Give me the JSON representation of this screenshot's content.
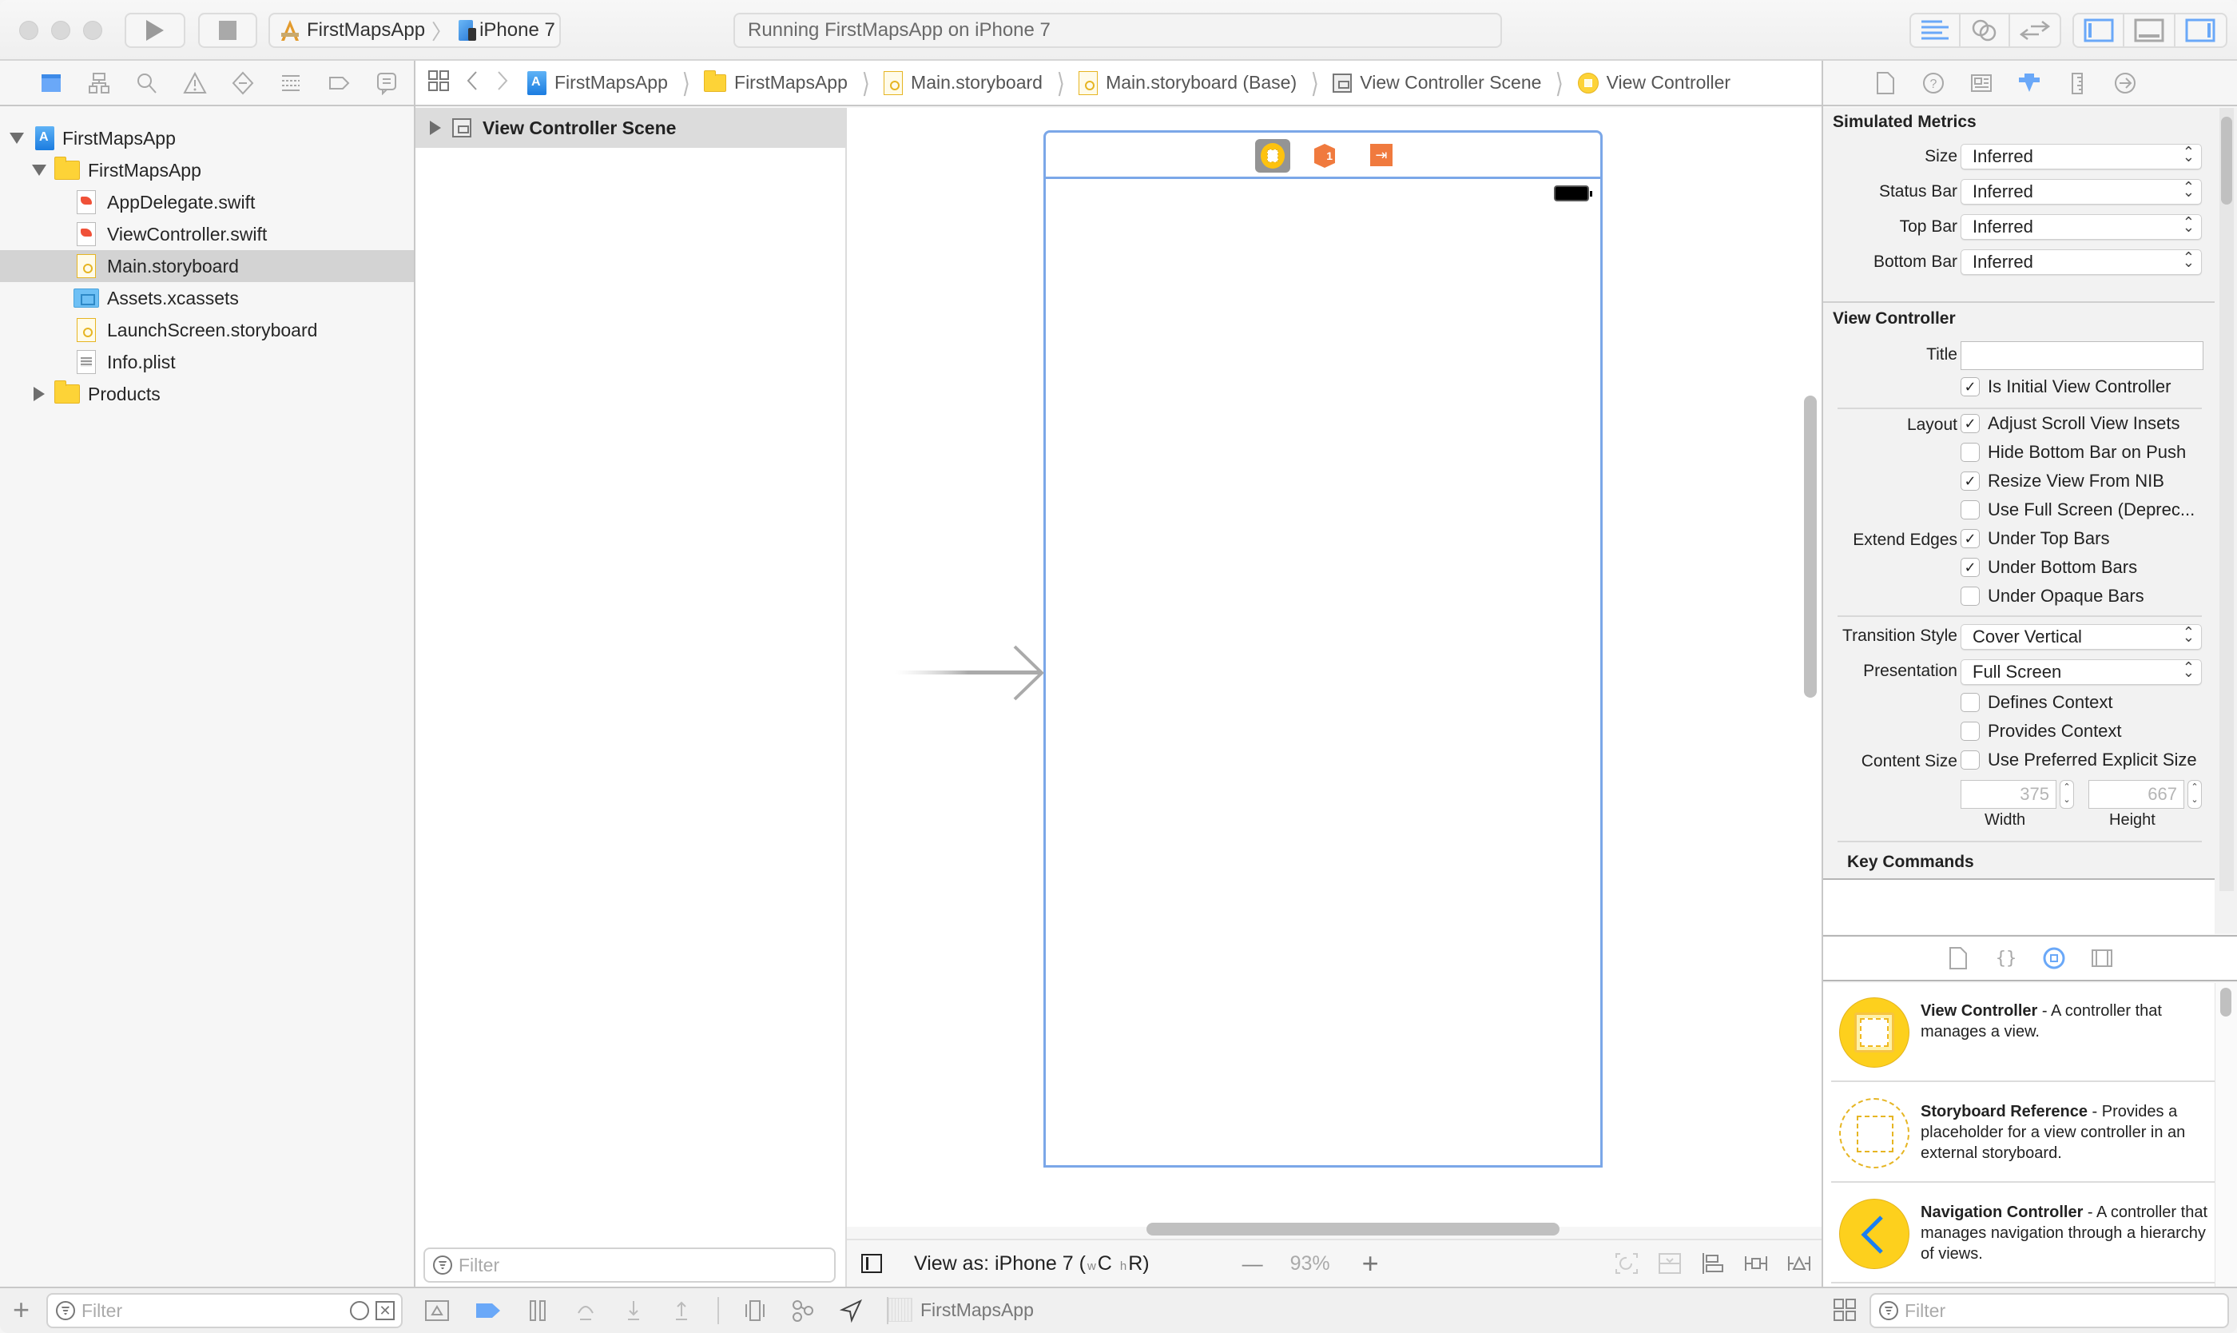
{
  "toolbar": {
    "scheme": "FirstMapsApp",
    "device": "iPhone 7",
    "status": "Running FirstMapsApp on iPhone 7",
    "accent": "#6aa8f8"
  },
  "navigator": {
    "tabs": [
      "project-navigator",
      "symbol-navigator",
      "find-navigator",
      "issue-navigator",
      "test-navigator",
      "debug-navigator",
      "breakpoint-navigator",
      "report-navigator"
    ],
    "items": [
      {
        "label": "FirstMapsApp",
        "kind": "project",
        "level": 0,
        "expanded": true
      },
      {
        "label": "FirstMapsApp",
        "kind": "folder",
        "level": 1,
        "expanded": true
      },
      {
        "label": "AppDelegate.swift",
        "kind": "swift",
        "level": 2
      },
      {
        "label": "ViewController.swift",
        "kind": "swift",
        "level": 2
      },
      {
        "label": "Main.storyboard",
        "kind": "storyboard",
        "level": 2,
        "selected": true
      },
      {
        "label": "Assets.xcassets",
        "kind": "assets",
        "level": 2
      },
      {
        "label": "LaunchScreen.storyboard",
        "kind": "storyboard",
        "level": 2
      },
      {
        "label": "Info.plist",
        "kind": "plist",
        "level": 2
      },
      {
        "label": "Products",
        "kind": "folder",
        "level": 1,
        "expanded": false
      }
    ],
    "filter_placeholder": "Filter"
  },
  "jumpbar": {
    "crumbs": [
      "FirstMapsApp",
      "FirstMapsApp",
      "Main.storyboard",
      "Main.storyboard (Base)",
      "View Controller Scene",
      "View Controller"
    ]
  },
  "outline": {
    "scene": "View Controller Scene",
    "filter_placeholder": "Filter"
  },
  "canvas": {
    "view_as": "View as: iPhone 7 (",
    "size_w": "w",
    "size_c": "C",
    "size_h": "h",
    "size_r": "R)",
    "zoom": "93%",
    "zoom_out": "—",
    "zoom_in": "+"
  },
  "debug_bar": {
    "app": "FirstMapsApp"
  },
  "inspector": {
    "simulated_metrics": {
      "title": "Simulated Metrics",
      "rows": [
        {
          "label": "Size",
          "value": "Inferred"
        },
        {
          "label": "Status Bar",
          "value": "Inferred"
        },
        {
          "label": "Top Bar",
          "value": "Inferred"
        },
        {
          "label": "Bottom Bar",
          "value": "Inferred"
        }
      ]
    },
    "view_controller": {
      "title": "View Controller",
      "title_label": "Title",
      "title_value": "",
      "is_initial": {
        "label": "Is Initial View Controller",
        "checked": true
      },
      "layout_label": "Layout",
      "layout": [
        {
          "label": "Adjust Scroll View Insets",
          "checked": true
        },
        {
          "label": "Hide Bottom Bar on Push",
          "checked": false
        },
        {
          "label": "Resize View From NIB",
          "checked": true
        },
        {
          "label": "Use Full Screen (Deprec...",
          "checked": false
        }
      ],
      "extend_edges_label": "Extend Edges",
      "extend_edges": [
        {
          "label": "Under Top Bars",
          "checked": true
        },
        {
          "label": "Under Bottom Bars",
          "checked": true
        },
        {
          "label": "Under Opaque Bars",
          "checked": false
        }
      ],
      "transition_style_label": "Transition Style",
      "transition_style": "Cover Vertical",
      "presentation_label": "Presentation",
      "presentation": "Full Screen",
      "context": [
        {
          "label": "Defines Context",
          "checked": false
        },
        {
          "label": "Provides Context",
          "checked": false
        }
      ],
      "content_size_label": "Content Size",
      "preferred_size": {
        "label": "Use Preferred Explicit Size",
        "checked": false
      },
      "width_value": "375",
      "height_value": "667",
      "width_label": "Width",
      "height_label": "Height"
    },
    "key_commands": "Key Commands"
  },
  "library": {
    "items": [
      {
        "name": "View Controller",
        "desc": " - A controller that manages a view."
      },
      {
        "name": "Storyboard Reference",
        "desc": " - Provides a placeholder for a view controller in an external storyboard."
      },
      {
        "name": "Navigation Controller",
        "desc": " - A controller that manages navigation through a hierarchy of views."
      }
    ],
    "filter_placeholder": "Filter"
  }
}
